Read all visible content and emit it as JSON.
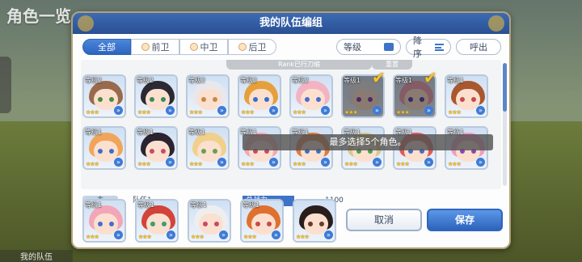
{
  "background": {
    "title": "角色一览",
    "side_label": "我的队伍"
  },
  "dialog": {
    "title": "我的队伍编组",
    "tabs": [
      {
        "label": "全部",
        "active": true
      },
      {
        "label": "前卫",
        "active": false
      },
      {
        "label": "中卫",
        "active": false
      },
      {
        "label": "后卫",
        "active": false
      }
    ],
    "level_toggle_label": "等级",
    "sort_label": "降序",
    "call_label": "呼出",
    "top_strip_left": "Rank已行刀缩",
    "top_strip_right": "重置"
  },
  "grid": {
    "row1": [
      {
        "level": "等级2",
        "stars": "★★★",
        "hair": "#9a6a4c",
        "eyes": "#4a8a3c"
      },
      {
        "level": "等级2",
        "stars": "★★★",
        "hair": "#2b2a33",
        "eyes": "#3c8a5a"
      },
      {
        "level": "等级2",
        "stars": "★★★",
        "hair": "#e8e8ec",
        "eyes": "#c8884a"
      },
      {
        "level": "等级2",
        "stars": "★★★",
        "hair": "#e5a03c",
        "eyes": "#3a6cc8"
      },
      {
        "level": "等级2",
        "stars": "★★★",
        "hair": "#f3b3c2",
        "eyes": "#4a6cd0"
      },
      {
        "level": "等级1",
        "stars": "★★★",
        "hair": "#e4e4e8",
        "eyes": "#8c4ab0",
        "selected": true
      },
      {
        "level": "等级1",
        "stars": "★★★",
        "hair": "#f2a6b8",
        "eyes": "#5f4ab0",
        "selected": true
      },
      {
        "level": "等级1",
        "stars": "★★★",
        "hair": "#a9572e",
        "eyes": "#c84a4a"
      }
    ],
    "row2": [
      {
        "level": "等级1",
        "stars": "★★★",
        "hair": "#f1a55b",
        "eyes": "#3c70c6"
      },
      {
        "level": "等级1",
        "stars": "★★★",
        "hair": "#2b2330",
        "eyes": "#c84a6a"
      },
      {
        "level": "等级1",
        "stars": "★★★",
        "hair": "#f0d08a",
        "eyes": "#6aa04a"
      },
      {
        "level": "等级1",
        "stars": "★★★",
        "hair": "#f2a8b2",
        "eyes": "#c84a6a"
      },
      {
        "level": "等级1",
        "stars": "★★★",
        "hair": "#e07a3a",
        "eyes": "#3c70c6"
      },
      {
        "level": "等级1",
        "stars": "★★★",
        "hair": "#d9c78c",
        "eyes": "#4aa04a"
      },
      {
        "level": "等级1",
        "stars": "★★★",
        "hair": "#e05a5a",
        "eyes": "#4a6cd0"
      },
      {
        "level": "等级1",
        "stars": "★★★",
        "hair": "#f19cc0",
        "eyes": "#8c4ab0"
      }
    ],
    "toast": "最多选择5个角色。"
  },
  "team": {
    "tag": "未",
    "name": "队伍1",
    "power_label": "总战力",
    "power_value": "1100",
    "members": [
      {
        "level": "等级1",
        "stars": "★★★",
        "hair": "#f3a6b8",
        "eyes": "#4a6cd0"
      },
      {
        "level": "等级1",
        "stars": "★★★",
        "hair": "#d2443a",
        "eyes": "#3ca06a"
      },
      {
        "level": "等级1",
        "stars": "★★★",
        "hair": "#eeeef0",
        "eyes": "#c84a6a"
      },
      {
        "level": "等级1",
        "stars": "★★★",
        "hair": "#e0702e",
        "eyes": "#c84a4a"
      },
      {
        "level": "",
        "stars": "★★★",
        "hair": "#2a1e1a",
        "eyes": "#6a3a2a"
      }
    ]
  },
  "buttons": {
    "cancel": "取消",
    "save": "保存"
  }
}
